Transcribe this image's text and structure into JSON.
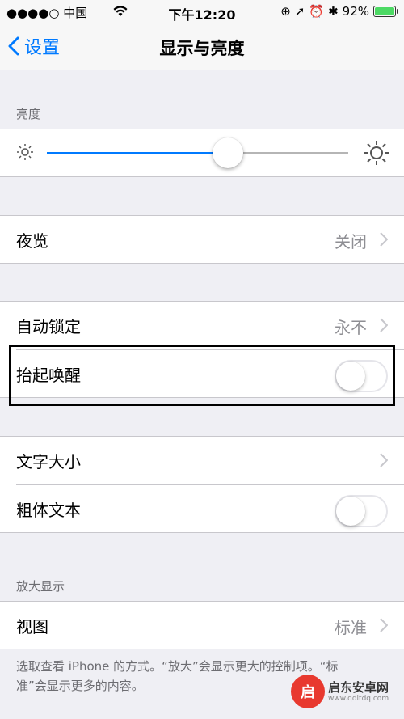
{
  "status_bar": {
    "carrier": "中国",
    "time": "下午12:20",
    "battery": "92%",
    "battery_level": 0.92,
    "icons": [
      "wifi-icon",
      "rotation-lock-icon",
      "location-icon",
      "alarm-icon",
      "bluetooth-icon",
      "battery-icon"
    ]
  },
  "nav": {
    "back_label": "设置",
    "title": "显示与亮度"
  },
  "brightness": {
    "header": "亮度",
    "level": 0.6
  },
  "night_shift": {
    "label": "夜览",
    "value": "关闭"
  },
  "auto_lock": {
    "label": "自动锁定",
    "value": "永不"
  },
  "raise_to_wake": {
    "label": "抬起唤醒",
    "enabled": false
  },
  "text_size": {
    "label": "文字大小"
  },
  "bold_text": {
    "label": "粗体文本",
    "enabled": false
  },
  "display_zoom": {
    "header": "放大显示",
    "view_label": "视图",
    "view_value": "标准",
    "footer": "选取查看 iPhone 的方式。“放大”会显示更大的控制项。“标准”会显示更多的内容。"
  },
  "watermark": {
    "name": "启东安卓网",
    "url": "www.qdltdq.com"
  },
  "colors": {
    "accent": "#007aff",
    "toggle_off_border": "#e5e5ea",
    "background": "#efeff4"
  }
}
